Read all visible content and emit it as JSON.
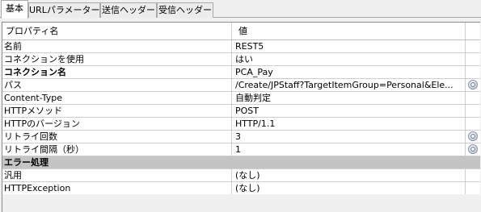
{
  "tabs": [
    {
      "label": "基本"
    },
    {
      "label": "URLパラメーター"
    },
    {
      "label": "送信ヘッダー"
    },
    {
      "label": "受信ヘッダー"
    }
  ],
  "grid": {
    "header": {
      "name": "プロパティ名",
      "value": "値"
    },
    "rows": [
      {
        "name": "名前",
        "value": "REST5"
      },
      {
        "name": "コネクションを使用",
        "value": "はい"
      },
      {
        "name": "コネクション名",
        "value": "PCA_Pay"
      },
      {
        "name": "パス",
        "value": "/Create/JPStaff?TargetItemGroup=Personal&Ele..."
      },
      {
        "name": "Content-Type",
        "value": "自動判定"
      },
      {
        "name": "HTTPメソッド",
        "value": "POST"
      },
      {
        "name": "HTTPのバージョン",
        "value": "HTTP/1.1"
      },
      {
        "name": "リトライ回数",
        "value": "3"
      },
      {
        "name": "リトライ間隔（秒）",
        "value": "1"
      },
      {
        "name": "エラー処理",
        "value": ""
      },
      {
        "name": "汎用",
        "value": "(なし)"
      },
      {
        "name": "HTTPException",
        "value": "(なし)"
      }
    ]
  }
}
